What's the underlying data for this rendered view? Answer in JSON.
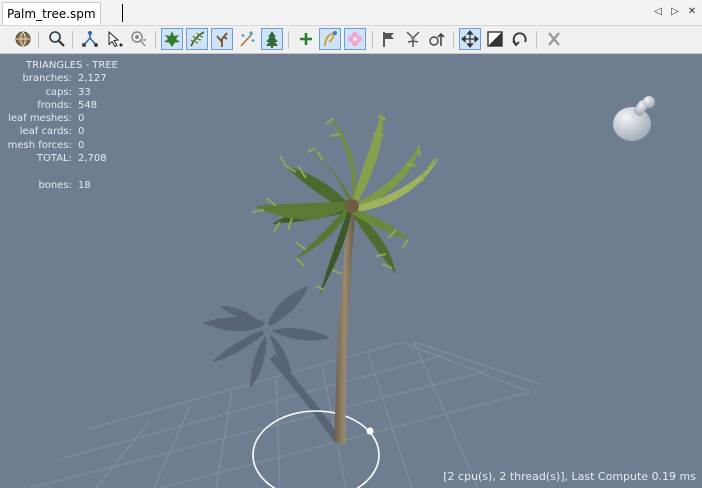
{
  "tab": {
    "title": "Palm_tree.spm"
  },
  "tab_controls": {
    "prev": "◁",
    "next": "▷",
    "close": "✕"
  },
  "toolbar": {
    "buttons": [
      {
        "icon": "globe-icon",
        "active": false
      },
      {
        "icon": "magnifier-icon",
        "active": false
      },
      {
        "icon": "skeleton-select-icon",
        "active": false
      },
      {
        "icon": "pointer-select-icon",
        "active": false
      },
      {
        "icon": "cluster-select-icon",
        "active": false
      },
      {
        "icon": "leaf-icon",
        "active": true
      },
      {
        "icon": "frond-icon",
        "active": true
      },
      {
        "icon": "branches-icon",
        "active": true
      },
      {
        "icon": "sparkle-branch-icon",
        "active": false
      },
      {
        "icon": "pine-tree-icon",
        "active": true
      },
      {
        "icon": "add-icon",
        "active": false
      },
      {
        "icon": "wand-icon",
        "active": true
      },
      {
        "icon": "blossom-icon",
        "active": true
      },
      {
        "icon": "flag-icon",
        "active": false
      },
      {
        "icon": "branch-flare-icon",
        "active": false
      },
      {
        "icon": "branch-up-icon",
        "active": false
      },
      {
        "icon": "move-icon",
        "active": true
      },
      {
        "icon": "scale-icon",
        "active": false
      },
      {
        "icon": "rotate-icon",
        "active": false
      },
      {
        "icon": "delete-icon",
        "active": false
      }
    ]
  },
  "stats": {
    "heading": "TRIANGLES - TREE",
    "rows": [
      {
        "label": "branches:",
        "value": "2,127"
      },
      {
        "label": "caps:",
        "value": "33"
      },
      {
        "label": "fronds:",
        "value": "548"
      },
      {
        "label": "leaf meshes:",
        "value": "0"
      },
      {
        "label": "leaf cards:",
        "value": "0"
      },
      {
        "label": "mesh forces:",
        "value": "0"
      },
      {
        "label": "TOTAL:",
        "value": "2,708"
      },
      {
        "label": "",
        "value": ""
      },
      {
        "label": "bones:",
        "value": "18"
      }
    ]
  },
  "status_text": "[2 cpu(s), 2 thread(s)], Last Compute 0.19 ms",
  "colors": {
    "viewport_bg": "#6e7d8f",
    "grid": "#8593a3",
    "trunk": "#8a7a62",
    "frond_dark": "#3f5a2b",
    "frond_light": "#9fb35e",
    "selection_ring": "#ffffff",
    "active_button": "#cfe3f7"
  }
}
